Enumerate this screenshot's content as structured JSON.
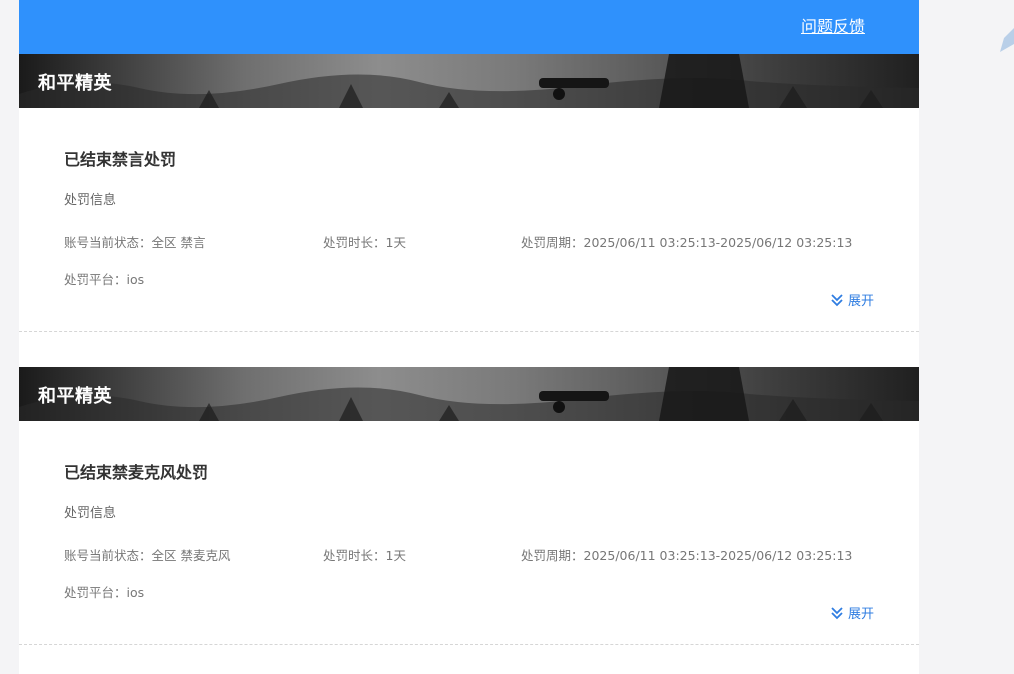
{
  "header": {
    "feedback_label": "问题反馈"
  },
  "records": [
    {
      "game": "和平精英",
      "title": "已结束禁言处罚",
      "subtitle": "处罚信息",
      "status_label": "账号当前状态：",
      "status_value": "全区 禁言",
      "duration_label": "处罚时长：",
      "duration_value": "1天",
      "period_label": "处罚周期：",
      "period_value": "2025/06/11 03:25:13-2025/06/12 03:25:13",
      "platform_label": "处罚平台：",
      "platform_value": "ios",
      "expand_label": "展开"
    },
    {
      "game": "和平精英",
      "title": "已结束禁麦克风处罚",
      "subtitle": "处罚信息",
      "status_label": "账号当前状态：",
      "status_value": "全区 禁麦克风",
      "duration_label": "处罚时长：",
      "duration_value": "1天",
      "period_label": "处罚周期：",
      "period_value": "2025/06/11 03:25:13-2025/06/12 03:25:13",
      "platform_label": "处罚平台：",
      "platform_value": "ios",
      "expand_label": "展开"
    }
  ],
  "colors": {
    "topbar": "#2f91fc",
    "link": "#2f7de1"
  }
}
